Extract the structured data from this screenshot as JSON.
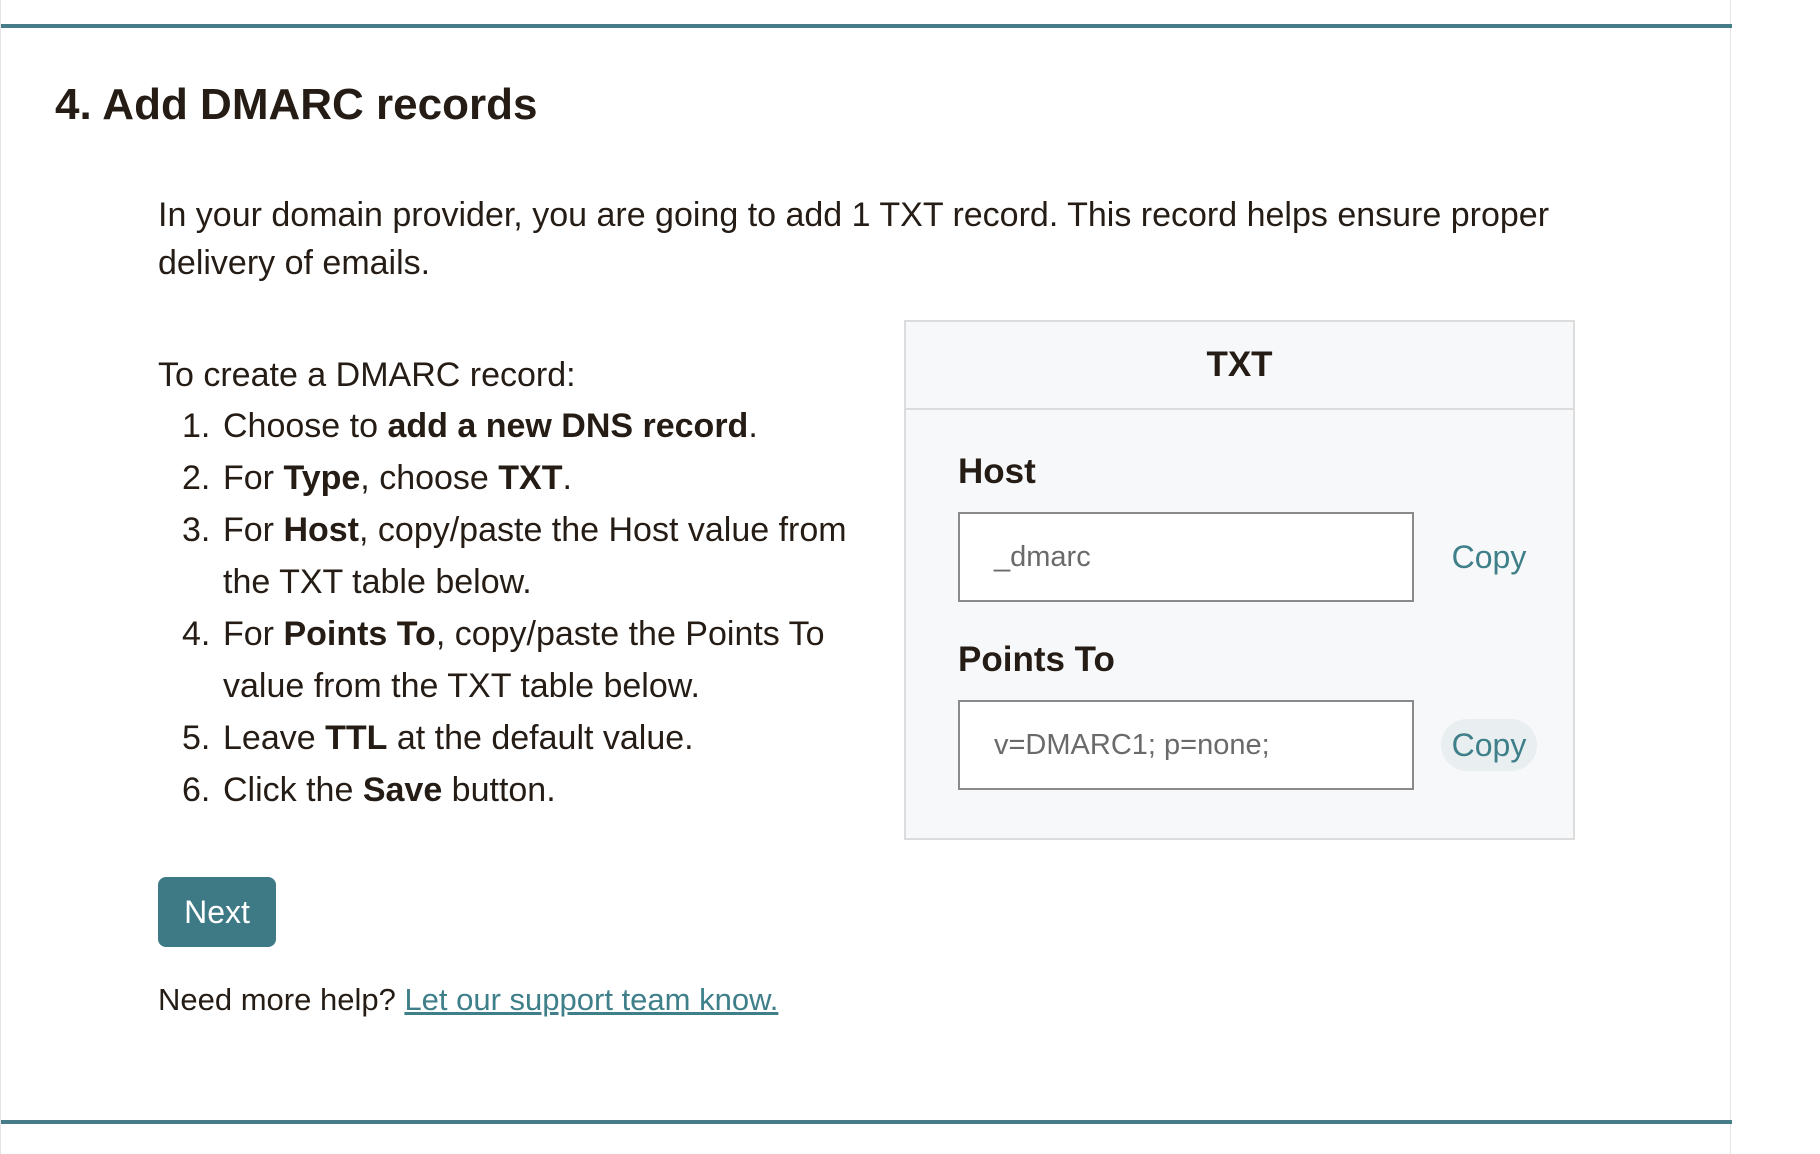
{
  "step": {
    "title": "4. Add DMARC records",
    "intro": "In your domain provider, you are going to add 1 TXT record. This record helps ensure proper delivery of emails."
  },
  "instructions": {
    "heading": "To create a DMARC record:",
    "items": [
      {
        "num": "1.",
        "pre": "Choose to ",
        "bold": "add a new DNS record",
        "post": "."
      },
      {
        "num": "2.",
        "pre": "For ",
        "bold": "Type",
        "mid": ", choose ",
        "bold2": "TXT",
        "post": "."
      },
      {
        "num": "3.",
        "pre": "For ",
        "bold": "Host",
        "post": ", copy/paste the Host value from the TXT table below."
      },
      {
        "num": "4.",
        "pre": "For ",
        "bold": "Points To",
        "post": ", copy/paste the Points To value from the TXT table below."
      },
      {
        "num": "5.",
        "pre": "Leave ",
        "bold": "TTL",
        "post": " at the default value."
      },
      {
        "num": "6.",
        "pre": "Click the ",
        "bold": "Save",
        "post": " button."
      }
    ]
  },
  "txt_table": {
    "header": "TXT",
    "host": {
      "label": "Host",
      "value": "_dmarc",
      "copy_label": "Copy"
    },
    "points_to": {
      "label": "Points To",
      "value": "v=DMARC1; p=none;",
      "copy_label": "Copy"
    }
  },
  "actions": {
    "next_label": "Next"
  },
  "help": {
    "prefix": "Need more help? ",
    "link_text": "Let our support team know."
  },
  "colors": {
    "accent": "#3d7a86",
    "rule": "#467c87",
    "link": "#3e7f89",
    "text": "#241c15"
  }
}
